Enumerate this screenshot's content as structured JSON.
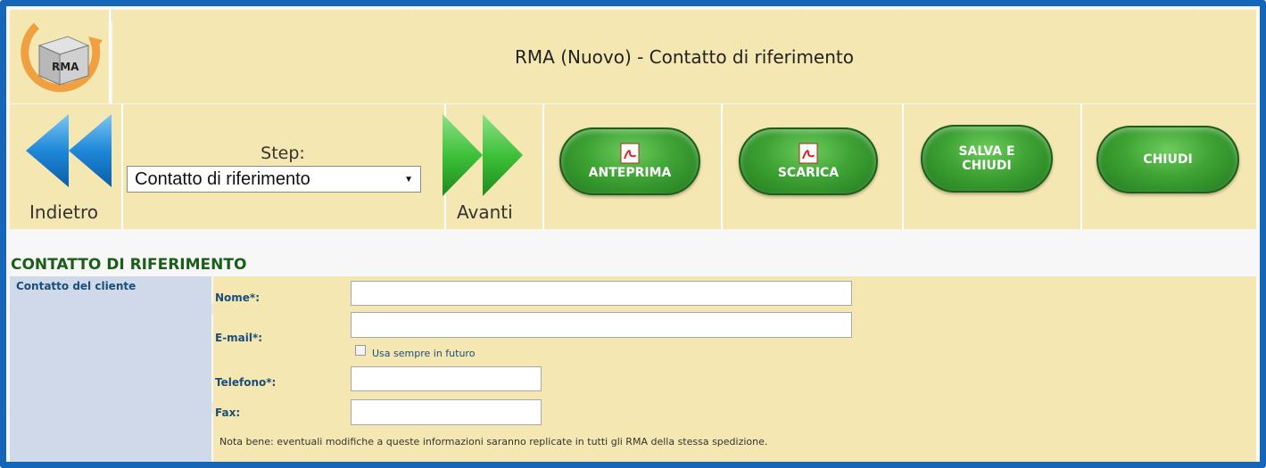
{
  "header": {
    "title": "RMA (Nuovo) - Contatto di riferimento",
    "logo_text": "RMA"
  },
  "toolbar": {
    "back_label": "Indietro",
    "next_label": "Avanti",
    "step_label": "Step:",
    "step_selected": "Contatto di riferimento",
    "buttons": {
      "anteprima": "ANTEPRIMA",
      "scarica": "SCARICA",
      "salva_line1": "SALVA E",
      "salva_line2": "CHIUDI",
      "chiudi": "CHIUDI"
    }
  },
  "section": {
    "title": "CONTATTO DI RIFERIMENTO",
    "group_label": "Contatto del cliente",
    "fields": {
      "nome_label": "Nome*:",
      "nome_value": "",
      "email_label": "E-mail*:",
      "email_value": "",
      "checkbox_label": "Usa sempre in futuro",
      "telefono_label": "Telefono*:",
      "telefono_value": "",
      "fax_label": "Fax:",
      "fax_value": ""
    },
    "note": "Nota bene: eventuali modifiche a queste informazioni saranno replicate in tutti gli RMA della stessa spedizione."
  },
  "colors": {
    "frame": "#1565b8",
    "panel": "#f5e7b2",
    "label": "#1a4e7a",
    "section_title": "#1a5e1a",
    "button_green": "#3ea334",
    "nav_blue": "#1e88d8",
    "nav_green": "#3ec13a"
  }
}
